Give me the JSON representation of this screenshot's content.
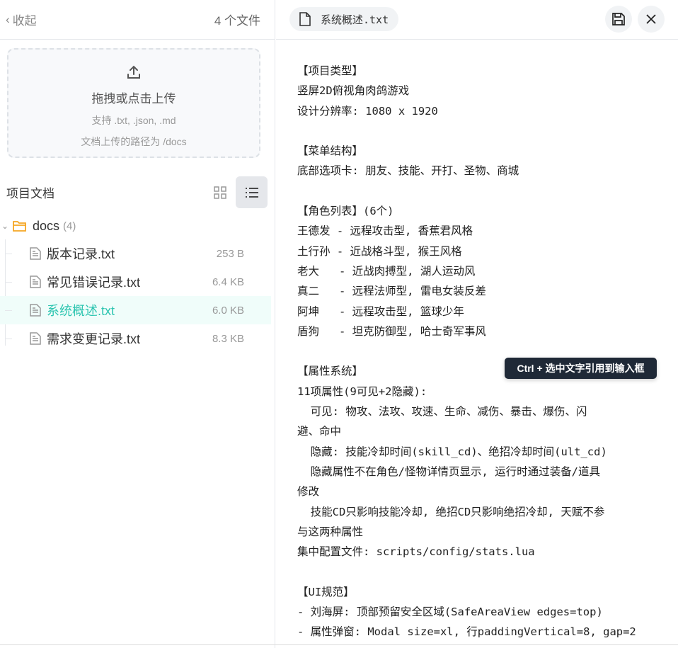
{
  "sidebar": {
    "collapse_label": "收起",
    "file_count": "4 个文件",
    "upload": {
      "title": "拖拽或点击上传",
      "formats": "支持 .txt, .json, .md",
      "path_note": "文档上传的路径为 /docs"
    },
    "section_title": "项目文档",
    "folder": {
      "name": "docs",
      "count": "(4)"
    },
    "files": [
      {
        "name": "版本记录.txt",
        "size": "253 B"
      },
      {
        "name": "常见错误记录.txt",
        "size": "6.4 KB"
      },
      {
        "name": "系统概述.txt",
        "size": "6.0 KB",
        "selected": true
      },
      {
        "name": "需求变更记录.txt",
        "size": "8.3 KB"
      }
    ]
  },
  "editor": {
    "tab_title": "系统概述.txt",
    "tooltip": "Ctrl + 选中文字引用到输入框",
    "lines": [
      "【项目类型】",
      "竖屏2D俯视角肉鸽游戏",
      "设计分辨率: 1080 x 1920",
      "",
      "【菜单结构】",
      "底部选项卡: 朋友、技能、开打、圣物、商城",
      "",
      "【角色列表】(6个)",
      "王德发 - 远程攻击型, 香蕉君风格",
      "土行孙 - 近战格斗型, 猴王风格",
      "老大   - 近战肉搏型, 湖人运动风",
      "真二   - 远程法师型, 雷电女装反差",
      "阿坤   - 远程攻击型, 篮球少年",
      "盾狗   - 坦克防御型, 哈士奇军事风",
      "",
      "【属性系统】",
      "11项属性(9可见+2隐藏):",
      "  可见: 物攻、法攻、攻速、生命、减伤、暴击、爆伤、闪",
      "避、命中",
      "  隐藏: 技能冷却时间(skill_cd)、绝招冷却时间(ult_cd)",
      "  隐藏属性不在角色/怪物详情页显示, 运行时通过装备/道具",
      "修改",
      "  技能CD只影响技能冷却, 绝招CD只影响绝招冷却, 天赋不参",
      "与这两种属性",
      "集中配置文件: scripts/config/stats.lua",
      "",
      "【UI规范】",
      "- 刘海屏: 顶部预留安全区域(SafeAreaView edges=top)",
      "- 属性弹窗: Modal size=xl, 行paddingVertical=8, gap=2"
    ]
  }
}
